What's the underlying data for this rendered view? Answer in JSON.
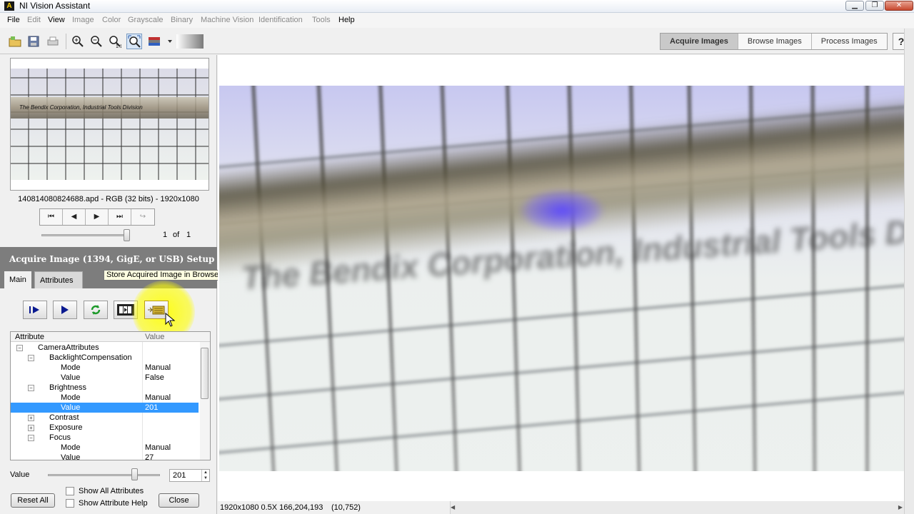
{
  "window": {
    "title": "NI Vision Assistant",
    "icon_label": "A",
    "controls": {
      "minimize": "▁",
      "maximize": "❐",
      "close": "✕"
    }
  },
  "menu": {
    "file": "File",
    "edit": "Edit",
    "view": "View",
    "image": "Image",
    "color": "Color",
    "grayscale": "Grayscale",
    "binary": "Binary",
    "machine_vision": "Machine Vision",
    "identification": "Identification",
    "tools": "Tools",
    "help": "Help"
  },
  "toolbar_icons": [
    "open-icon",
    "save-icon",
    "print-icon",
    "zoom-in-icon",
    "zoom-out-icon",
    "zoom-1to1-icon",
    "zoom-fit-icon",
    "palette-icon",
    "gradient-icon"
  ],
  "modes": {
    "acquire": "Acquire Images",
    "browse": "Browse Images",
    "process": "Process Images",
    "help": "?"
  },
  "thumbnail": {
    "caption_text": "The Bendix Corporation, Industrial Tools Division",
    "info": "140814080824688.apd - RGB (32 bits) - 1920x1080"
  },
  "navigation": {
    "first": "⏮",
    "prev": "◀",
    "next": "▶",
    "last": "⏭",
    "return": "↪",
    "current": "1",
    "of": "of",
    "total": "1"
  },
  "setup": {
    "header": "Acquire Image (1394, GigE, or USB) Setup",
    "tabs": {
      "main": "Main",
      "attributes": "Attributes"
    },
    "tooltip": "Store Acquired Image in Browser"
  },
  "tree": {
    "col_attribute": "Attribute",
    "col_value": "Value",
    "rows": [
      {
        "label": "CameraAttributes",
        "value": "",
        "exp": "−"
      },
      {
        "label": "BacklightCompensation",
        "value": "",
        "exp": "−"
      },
      {
        "label": "Mode",
        "value": "Manual",
        "exp": ""
      },
      {
        "label": "Value",
        "value": "False",
        "exp": ""
      },
      {
        "label": "Brightness",
        "value": "",
        "exp": "−"
      },
      {
        "label": "Mode",
        "value": "Manual",
        "exp": ""
      },
      {
        "label": "Value",
        "value": "201",
        "exp": ""
      },
      {
        "label": "Contrast",
        "value": "",
        "exp": "+"
      },
      {
        "label": "Exposure",
        "value": "",
        "exp": "+"
      },
      {
        "label": "Focus",
        "value": "",
        "exp": "−"
      },
      {
        "label": "Mode",
        "value": "Manual",
        "exp": ""
      },
      {
        "label": "Value",
        "value": "27",
        "exp": ""
      }
    ]
  },
  "value_control": {
    "label": "Value",
    "value": "201",
    "min": 0,
    "max": 255
  },
  "buttons": {
    "reset_all": "Reset All",
    "close": "Close",
    "show_all": "Show All Attributes",
    "show_help": "Show Attribute Help"
  },
  "status": {
    "info": "1920x1080 0.5X 166,204,193",
    "coords": "(10,752)"
  },
  "colors": {
    "accent_select": "#3399ff",
    "header_bg": "#7d7d7d",
    "highlight": "#ffff00"
  }
}
